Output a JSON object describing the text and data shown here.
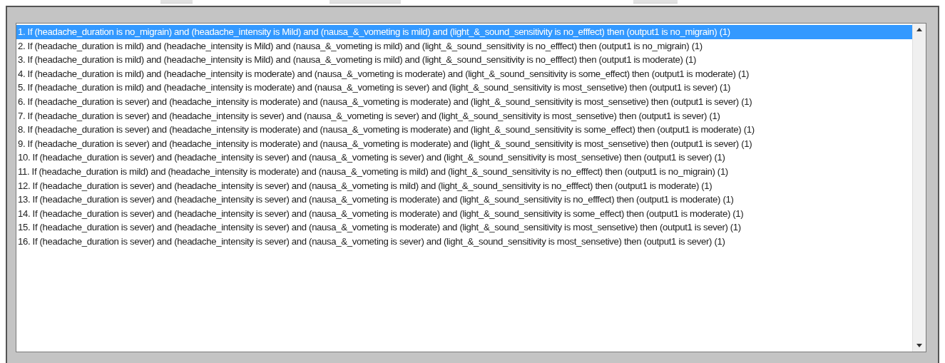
{
  "rules_list": {
    "items": [
      {
        "text": "1. If (headache_duration is no_migrain) and (headache_intensity is Mild) and (nausa_&_vometing is mild) and (light_&_sound_sensitivity is no_efffect) then (output1 is no_migrain) (1)",
        "selected": true
      },
      {
        "text": "2. If (headache_duration is mild) and (headache_intensity is Mild) and (nausa_&_vometing is mild) and (light_&_sound_sensitivity is no_efffect) then (output1 is no_migrain) (1)",
        "selected": false
      },
      {
        "text": "3. If (headache_duration is mild) and (headache_intensity is Mild) and (nausa_&_vometing is mild) and (light_&_sound_sensitivity is no_efffect) then (output1 is moderate) (1)",
        "selected": false
      },
      {
        "text": "4. If (headache_duration is mild) and (headache_intensity is moderate) and (nausa_&_vometing is moderate) and (light_&_sound_sensitivity is some_effect) then (output1 is moderate) (1)",
        "selected": false
      },
      {
        "text": "5. If (headache_duration is mild) and (headache_intensity is moderate) and (nausa_&_vometing is sever) and (light_&_sound_sensitivity is most_sensetive) then (output1 is sever) (1)",
        "selected": false
      },
      {
        "text": "6. If (headache_duration is sever) and (headache_intensity is moderate) and (nausa_&_vometing is moderate) and (light_&_sound_sensitivity is most_sensetive) then (output1 is sever) (1)",
        "selected": false
      },
      {
        "text": "7. If (headache_duration is sever) and (headache_intensity is sever) and (nausa_&_vometing is sever) and (light_&_sound_sensitivity is most_sensetive) then (output1 is sever) (1)",
        "selected": false
      },
      {
        "text": "8. If (headache_duration is sever) and (headache_intensity is moderate) and (nausa_&_vometing is moderate) and (light_&_sound_sensitivity is some_effect) then (output1 is moderate) (1)",
        "selected": false
      },
      {
        "text": "9. If (headache_duration is sever) and (headache_intensity is moderate) and (nausa_&_vometing is moderate) and (light_&_sound_sensitivity is most_sensetive) then (output1 is sever) (1)",
        "selected": false
      },
      {
        "text": "10. If (headache_duration is sever) and (headache_intensity is sever) and (nausa_&_vometing is sever) and (light_&_sound_sensitivity is most_sensetive) then (output1 is sever) (1)",
        "selected": false
      },
      {
        "text": "11. If (headache_duration is mild) and (headache_intensity is moderate) and (nausa_&_vometing is mild) and (light_&_sound_sensitivity is no_efffect) then (output1 is no_migrain) (1)",
        "selected": false
      },
      {
        "text": "12. If (headache_duration is sever) and (headache_intensity is sever) and (nausa_&_vometing is mild) and (light_&_sound_sensitivity is no_efffect) then (output1 is moderate) (1)",
        "selected": false
      },
      {
        "text": "13. If (headache_duration is sever) and (headache_intensity is sever) and (nausa_&_vometing is moderate) and (light_&_sound_sensitivity is no_efffect) then (output1 is moderate) (1)",
        "selected": false
      },
      {
        "text": "14. If (headache_duration is sever) and (headache_intensity is sever) and (nausa_&_vometing is moderate) and (light_&_sound_sensitivity is some_effect) then (output1 is moderate) (1)",
        "selected": false
      },
      {
        "text": "15. If (headache_duration is sever) and (headache_intensity is sever) and (nausa_&_vometing is moderate) and (light_&_sound_sensitivity is most_sensetive) then (output1 is sever) (1)",
        "selected": false
      },
      {
        "text": "16. If (headache_duration is sever) and (headache_intensity is sever) and (nausa_&_vometing is sever) and (light_&_sound_sensitivity is most_sensetive) then (output1 is sever) (1)",
        "selected": false
      }
    ]
  }
}
